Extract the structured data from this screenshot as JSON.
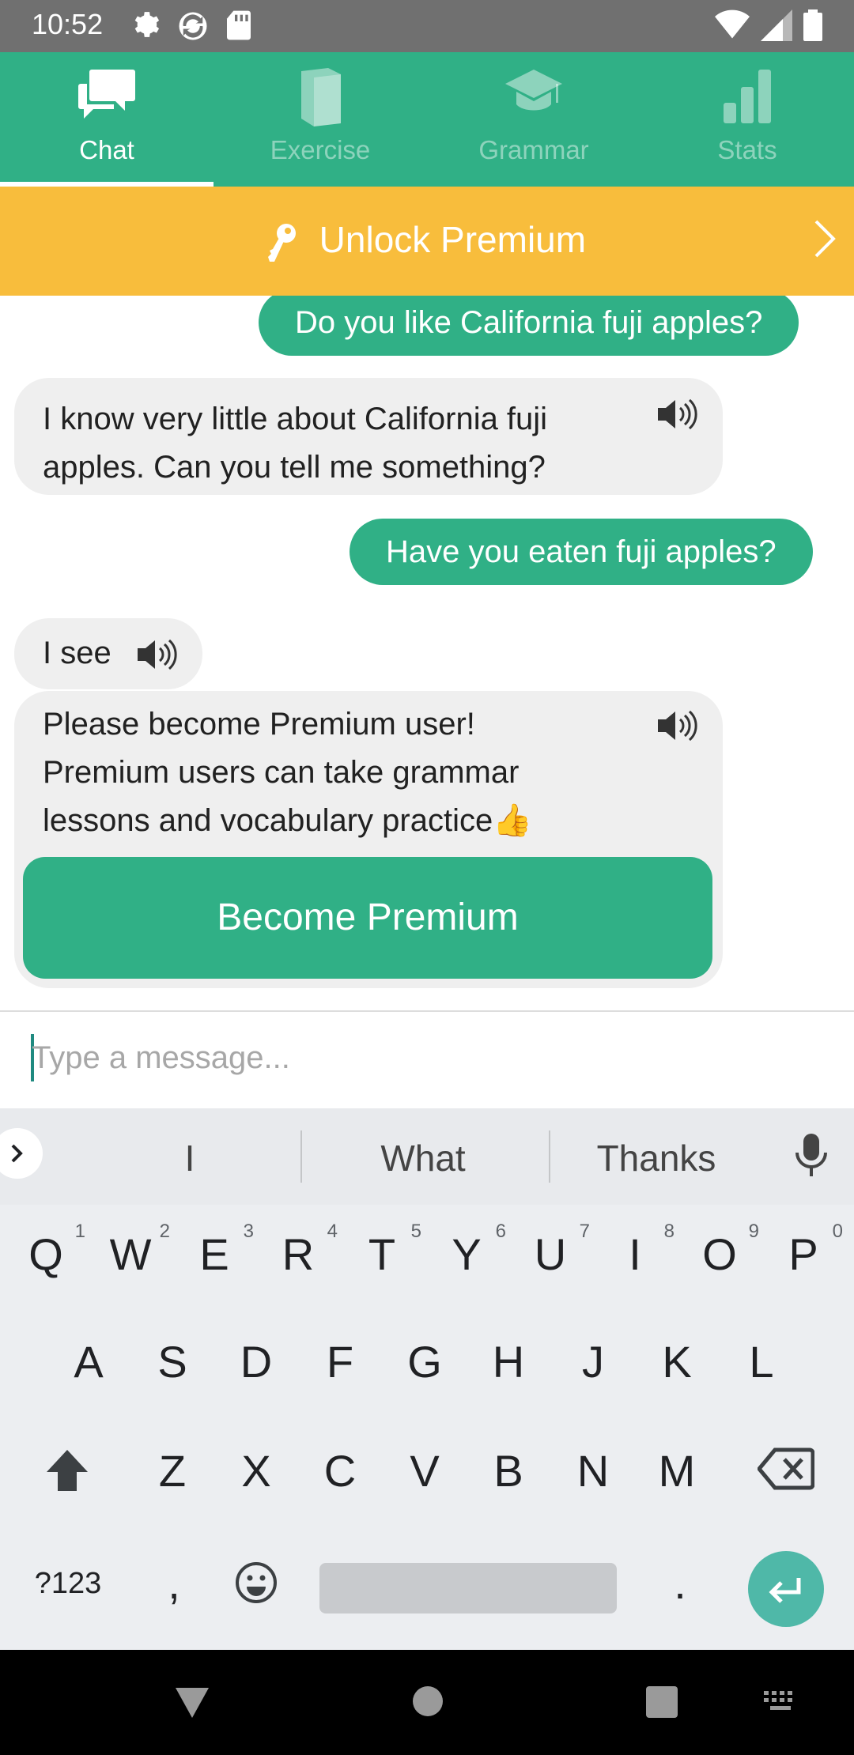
{
  "status_bar": {
    "time": "10:52",
    "left_icons": [
      "gear-icon",
      "sync-icon",
      "sd-card-icon"
    ],
    "right_icons": [
      "wifi-icon",
      "signal-icon",
      "battery-icon"
    ]
  },
  "tabs": [
    {
      "label": "Chat",
      "icon": "chat-icon",
      "active": true
    },
    {
      "label": "Exercise",
      "icon": "book-icon",
      "active": false
    },
    {
      "label": "Grammar",
      "icon": "graduation-cap-icon",
      "active": false
    },
    {
      "label": "Stats",
      "icon": "bar-chart-icon",
      "active": false
    }
  ],
  "banner": {
    "label": "Unlock Premium",
    "icon": "key-icon"
  },
  "messages": [
    {
      "from": "user",
      "text": "Do you like California fuji apples?"
    },
    {
      "from": "bot",
      "lines": [
        "I know very little about California fuji",
        "apples. Can you tell me something?"
      ]
    },
    {
      "from": "user",
      "text": "Have you eaten fuji apples?"
    },
    {
      "from": "bot",
      "lines": [
        "I see"
      ]
    },
    {
      "from": "bot",
      "lines": [
        "Please become Premium user!",
        "Premium users can take grammar",
        "lessons and vocabulary practice👍"
      ],
      "button": "Become Premium"
    }
  ],
  "input": {
    "placeholder": "Type a message..."
  },
  "keyboard": {
    "suggestions": [
      "I",
      "What",
      "Thanks"
    ],
    "row1": [
      {
        "key": "Q",
        "num": "1"
      },
      {
        "key": "W",
        "num": "2"
      },
      {
        "key": "E",
        "num": "3"
      },
      {
        "key": "R",
        "num": "4"
      },
      {
        "key": "T",
        "num": "5"
      },
      {
        "key": "Y",
        "num": "6"
      },
      {
        "key": "U",
        "num": "7"
      },
      {
        "key": "I",
        "num": "8"
      },
      {
        "key": "O",
        "num": "9"
      },
      {
        "key": "P",
        "num": "0"
      }
    ],
    "row2": [
      "A",
      "S",
      "D",
      "F",
      "G",
      "H",
      "J",
      "K",
      "L"
    ],
    "row3": [
      "Z",
      "X",
      "C",
      "V",
      "B",
      "N",
      "M"
    ],
    "row4": {
      "symbols": "?123",
      "comma": ",",
      "period": "."
    },
    "colors": {
      "background": "#e8eaed",
      "enter": "#4fb8a8",
      "accent": "#30b086"
    }
  },
  "nav": [
    "back-icon",
    "home-icon",
    "recents-icon",
    "keyboard-icon"
  ]
}
